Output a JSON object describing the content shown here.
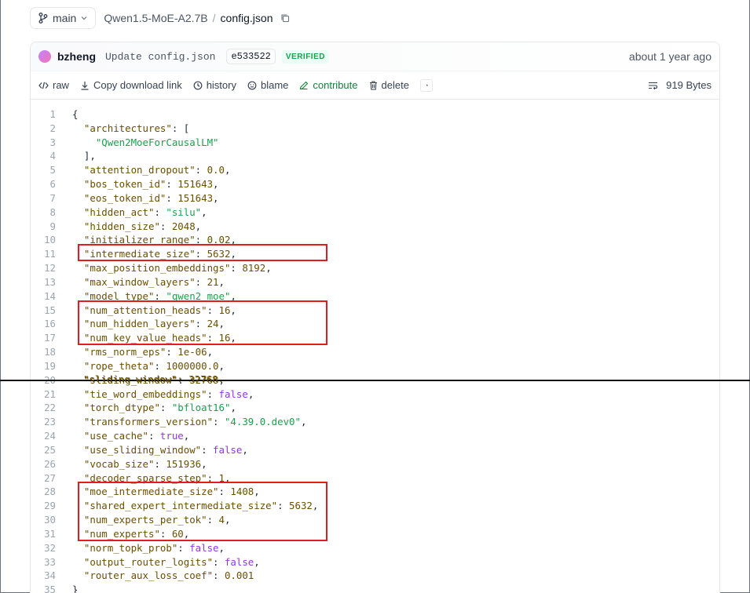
{
  "header": {
    "branch": "main",
    "repo": "Qwen1.5-MoE-A2.7B",
    "separator": "/",
    "file": "config.json"
  },
  "commit": {
    "author": "bzheng",
    "message": "Update config.json",
    "sha": "e533522",
    "badge": "VERIFIED",
    "time": "about 1 year ago"
  },
  "toolbar": {
    "raw": "raw",
    "copy_link": "Copy download link",
    "history": "history",
    "blame": "blame",
    "contribute": "contribute",
    "delete": "delete",
    "size": "919 Bytes"
  },
  "ghost_text": "\"sliding_window\": 32768,",
  "code_lines": [
    {
      "n": 1,
      "parts": [
        [
          "p",
          "{"
        ]
      ]
    },
    {
      "n": 2,
      "parts": [
        [
          "p",
          "  "
        ],
        [
          "k",
          "\"architectures\""
        ],
        [
          "p",
          ": ["
        ]
      ]
    },
    {
      "n": 3,
      "parts": [
        [
          "p",
          "    "
        ],
        [
          "s",
          "\"Qwen2MoeForCausalLM\""
        ]
      ]
    },
    {
      "n": 4,
      "parts": [
        [
          "p",
          "  ],"
        ]
      ]
    },
    {
      "n": 5,
      "parts": [
        [
          "p",
          "  "
        ],
        [
          "k",
          "\"attention_dropout\""
        ],
        [
          "p",
          ": "
        ],
        [
          "n",
          "0.0"
        ],
        [
          "p",
          ","
        ]
      ]
    },
    {
      "n": 6,
      "parts": [
        [
          "p",
          "  "
        ],
        [
          "k",
          "\"bos_token_id\""
        ],
        [
          "p",
          ": "
        ],
        [
          "n",
          "151643"
        ],
        [
          "p",
          ","
        ]
      ]
    },
    {
      "n": 7,
      "parts": [
        [
          "p",
          "  "
        ],
        [
          "k",
          "\"eos_token_id\""
        ],
        [
          "p",
          ": "
        ],
        [
          "n",
          "151643"
        ],
        [
          "p",
          ","
        ]
      ]
    },
    {
      "n": 8,
      "parts": [
        [
          "p",
          "  "
        ],
        [
          "k",
          "\"hidden_act\""
        ],
        [
          "p",
          ": "
        ],
        [
          "s",
          "\"silu\""
        ],
        [
          "p",
          ","
        ]
      ]
    },
    {
      "n": 9,
      "parts": [
        [
          "p",
          "  "
        ],
        [
          "k",
          "\"hidden_size\""
        ],
        [
          "p",
          ": "
        ],
        [
          "n",
          "2048"
        ],
        [
          "p",
          ","
        ]
      ]
    },
    {
      "n": 10,
      "parts": [
        [
          "p",
          "  "
        ],
        [
          "k",
          "\"initializer_range\""
        ],
        [
          "p",
          ": "
        ],
        [
          "n",
          "0.02"
        ],
        [
          "p",
          ","
        ]
      ]
    },
    {
      "n": 11,
      "parts": [
        [
          "p",
          "  "
        ],
        [
          "k",
          "\"intermediate_size\""
        ],
        [
          "p",
          ": "
        ],
        [
          "n",
          "5632"
        ],
        [
          "p",
          ","
        ]
      ]
    },
    {
      "n": 12,
      "parts": [
        [
          "p",
          "  "
        ],
        [
          "k",
          "\"max_position_embeddings\""
        ],
        [
          "p",
          ": "
        ],
        [
          "n",
          "8192"
        ],
        [
          "p",
          ","
        ]
      ]
    },
    {
      "n": 13,
      "parts": [
        [
          "p",
          "  "
        ],
        [
          "k",
          "\"max_window_layers\""
        ],
        [
          "p",
          ": "
        ],
        [
          "n",
          "21"
        ],
        [
          "p",
          ","
        ]
      ]
    },
    {
      "n": 14,
      "parts": [
        [
          "p",
          "  "
        ],
        [
          "k",
          "\"model_type\""
        ],
        [
          "p",
          ": "
        ],
        [
          "s",
          "\"qwen2_moe\""
        ],
        [
          "p",
          ","
        ]
      ]
    },
    {
      "n": 15,
      "parts": [
        [
          "p",
          "  "
        ],
        [
          "k",
          "\"num_attention_heads\""
        ],
        [
          "p",
          ": "
        ],
        [
          "n",
          "16"
        ],
        [
          "p",
          ","
        ]
      ]
    },
    {
      "n": 16,
      "parts": [
        [
          "p",
          "  "
        ],
        [
          "k",
          "\"num_hidden_layers\""
        ],
        [
          "p",
          ": "
        ],
        [
          "n",
          "24"
        ],
        [
          "p",
          ","
        ]
      ]
    },
    {
      "n": 17,
      "parts": [
        [
          "p",
          "  "
        ],
        [
          "k",
          "\"num_key_value_heads\""
        ],
        [
          "p",
          ": "
        ],
        [
          "n",
          "16"
        ],
        [
          "p",
          ","
        ]
      ]
    },
    {
      "n": 18,
      "parts": [
        [
          "p",
          "  "
        ],
        [
          "k",
          "\"rms_norm_eps\""
        ],
        [
          "p",
          ": "
        ],
        [
          "n",
          "1e-06"
        ],
        [
          "p",
          ","
        ]
      ]
    },
    {
      "n": 19,
      "parts": [
        [
          "p",
          "  "
        ],
        [
          "k",
          "\"rope_theta\""
        ],
        [
          "p",
          ": "
        ],
        [
          "n",
          "1000000.0"
        ],
        [
          "p",
          ","
        ]
      ]
    },
    {
      "n": 20,
      "parts": [
        [
          "p",
          "  "
        ],
        [
          "k",
          "\"sliding_window\""
        ],
        [
          "p",
          ": "
        ],
        [
          "n",
          "32768"
        ],
        [
          "p",
          ","
        ]
      ]
    },
    {
      "n": 21,
      "parts": [
        [
          "p",
          "  "
        ],
        [
          "k",
          "\"tie_word_embeddings\""
        ],
        [
          "p",
          ": "
        ],
        [
          "b",
          "false"
        ],
        [
          "p",
          ","
        ]
      ]
    },
    {
      "n": 22,
      "parts": [
        [
          "p",
          "  "
        ],
        [
          "k",
          "\"torch_dtype\""
        ],
        [
          "p",
          ": "
        ],
        [
          "s",
          "\"bfloat16\""
        ],
        [
          "p",
          ","
        ]
      ]
    },
    {
      "n": 23,
      "parts": [
        [
          "p",
          "  "
        ],
        [
          "k",
          "\"transformers_version\""
        ],
        [
          "p",
          ": "
        ],
        [
          "s",
          "\"4.39.0.dev0\""
        ],
        [
          "p",
          ","
        ]
      ]
    },
    {
      "n": 24,
      "parts": [
        [
          "p",
          "  "
        ],
        [
          "k",
          "\"use_cache\""
        ],
        [
          "p",
          ": "
        ],
        [
          "b",
          "true"
        ],
        [
          "p",
          ","
        ]
      ]
    },
    {
      "n": 25,
      "parts": [
        [
          "p",
          "  "
        ],
        [
          "k",
          "\"use_sliding_window\""
        ],
        [
          "p",
          ": "
        ],
        [
          "b",
          "false"
        ],
        [
          "p",
          ","
        ]
      ]
    },
    {
      "n": 26,
      "parts": [
        [
          "p",
          "  "
        ],
        [
          "k",
          "\"vocab_size\""
        ],
        [
          "p",
          ": "
        ],
        [
          "n",
          "151936"
        ],
        [
          "p",
          ","
        ]
      ]
    },
    {
      "n": 27,
      "parts": [
        [
          "p",
          "  "
        ],
        [
          "k",
          "\"decoder_sparse_step\""
        ],
        [
          "p",
          ": "
        ],
        [
          "n",
          "1"
        ],
        [
          "p",
          ","
        ]
      ]
    },
    {
      "n": 28,
      "parts": [
        [
          "p",
          "  "
        ],
        [
          "k",
          "\"moe_intermediate_size\""
        ],
        [
          "p",
          ": "
        ],
        [
          "n",
          "1408"
        ],
        [
          "p",
          ","
        ]
      ]
    },
    {
      "n": 29,
      "parts": [
        [
          "p",
          "  "
        ],
        [
          "k",
          "\"shared_expert_intermediate_size\""
        ],
        [
          "p",
          ": "
        ],
        [
          "n",
          "5632"
        ],
        [
          "p",
          ","
        ]
      ]
    },
    {
      "n": 30,
      "parts": [
        [
          "p",
          "  "
        ],
        [
          "k",
          "\"num_experts_per_tok\""
        ],
        [
          "p",
          ": "
        ],
        [
          "n",
          "4"
        ],
        [
          "p",
          ","
        ]
      ]
    },
    {
      "n": 31,
      "parts": [
        [
          "p",
          "  "
        ],
        [
          "k",
          "\"num_experts\""
        ],
        [
          "p",
          ": "
        ],
        [
          "n",
          "60"
        ],
        [
          "p",
          ","
        ]
      ]
    },
    {
      "n": 32,
      "parts": [
        [
          "p",
          "  "
        ],
        [
          "k",
          "\"norm_topk_prob\""
        ],
        [
          "p",
          ": "
        ],
        [
          "b",
          "false"
        ],
        [
          "p",
          ","
        ]
      ]
    },
    {
      "n": 33,
      "parts": [
        [
          "p",
          "  "
        ],
        [
          "k",
          "\"output_router_logits\""
        ],
        [
          "p",
          ": "
        ],
        [
          "b",
          "false"
        ],
        [
          "p",
          ","
        ]
      ]
    },
    {
      "n": 34,
      "parts": [
        [
          "p",
          "  "
        ],
        [
          "k",
          "\"router_aux_loss_coef\""
        ],
        [
          "p",
          ": "
        ],
        [
          "n",
          "0.001"
        ]
      ]
    },
    {
      "n": 35,
      "parts": [
        [
          "p",
          "}"
        ]
      ]
    }
  ],
  "highlight_groups": [
    [
      11,
      11
    ],
    [
      15,
      17
    ],
    [
      28,
      31
    ]
  ]
}
